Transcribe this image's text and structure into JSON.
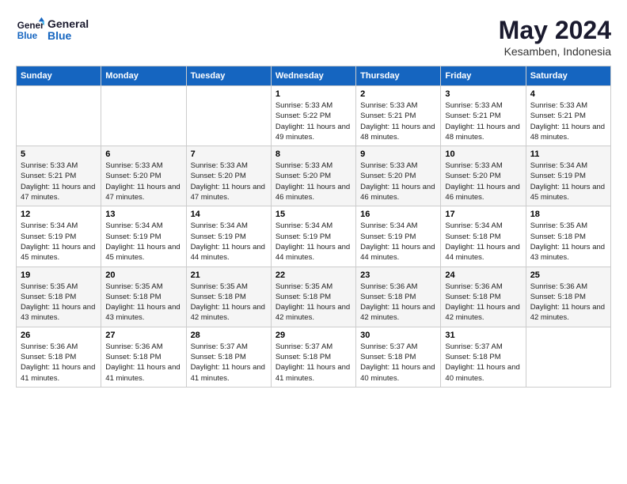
{
  "logo": {
    "text1": "General",
    "text2": "Blue"
  },
  "title": "May 2024",
  "location": "Kesamben, Indonesia",
  "weekdays": [
    "Sunday",
    "Monday",
    "Tuesday",
    "Wednesday",
    "Thursday",
    "Friday",
    "Saturday"
  ],
  "weeks": [
    [
      {
        "day": "",
        "sunrise": "",
        "sunset": "",
        "daylight": ""
      },
      {
        "day": "",
        "sunrise": "",
        "sunset": "",
        "daylight": ""
      },
      {
        "day": "",
        "sunrise": "",
        "sunset": "",
        "daylight": ""
      },
      {
        "day": "1",
        "sunrise": "Sunrise: 5:33 AM",
        "sunset": "Sunset: 5:22 PM",
        "daylight": "Daylight: 11 hours and 49 minutes."
      },
      {
        "day": "2",
        "sunrise": "Sunrise: 5:33 AM",
        "sunset": "Sunset: 5:21 PM",
        "daylight": "Daylight: 11 hours and 48 minutes."
      },
      {
        "day": "3",
        "sunrise": "Sunrise: 5:33 AM",
        "sunset": "Sunset: 5:21 PM",
        "daylight": "Daylight: 11 hours and 48 minutes."
      },
      {
        "day": "4",
        "sunrise": "Sunrise: 5:33 AM",
        "sunset": "Sunset: 5:21 PM",
        "daylight": "Daylight: 11 hours and 48 minutes."
      }
    ],
    [
      {
        "day": "5",
        "sunrise": "Sunrise: 5:33 AM",
        "sunset": "Sunset: 5:21 PM",
        "daylight": "Daylight: 11 hours and 47 minutes."
      },
      {
        "day": "6",
        "sunrise": "Sunrise: 5:33 AM",
        "sunset": "Sunset: 5:20 PM",
        "daylight": "Daylight: 11 hours and 47 minutes."
      },
      {
        "day": "7",
        "sunrise": "Sunrise: 5:33 AM",
        "sunset": "Sunset: 5:20 PM",
        "daylight": "Daylight: 11 hours and 47 minutes."
      },
      {
        "day": "8",
        "sunrise": "Sunrise: 5:33 AM",
        "sunset": "Sunset: 5:20 PM",
        "daylight": "Daylight: 11 hours and 46 minutes."
      },
      {
        "day": "9",
        "sunrise": "Sunrise: 5:33 AM",
        "sunset": "Sunset: 5:20 PM",
        "daylight": "Daylight: 11 hours and 46 minutes."
      },
      {
        "day": "10",
        "sunrise": "Sunrise: 5:33 AM",
        "sunset": "Sunset: 5:20 PM",
        "daylight": "Daylight: 11 hours and 46 minutes."
      },
      {
        "day": "11",
        "sunrise": "Sunrise: 5:34 AM",
        "sunset": "Sunset: 5:19 PM",
        "daylight": "Daylight: 11 hours and 45 minutes."
      }
    ],
    [
      {
        "day": "12",
        "sunrise": "Sunrise: 5:34 AM",
        "sunset": "Sunset: 5:19 PM",
        "daylight": "Daylight: 11 hours and 45 minutes."
      },
      {
        "day": "13",
        "sunrise": "Sunrise: 5:34 AM",
        "sunset": "Sunset: 5:19 PM",
        "daylight": "Daylight: 11 hours and 45 minutes."
      },
      {
        "day": "14",
        "sunrise": "Sunrise: 5:34 AM",
        "sunset": "Sunset: 5:19 PM",
        "daylight": "Daylight: 11 hours and 44 minutes."
      },
      {
        "day": "15",
        "sunrise": "Sunrise: 5:34 AM",
        "sunset": "Sunset: 5:19 PM",
        "daylight": "Daylight: 11 hours and 44 minutes."
      },
      {
        "day": "16",
        "sunrise": "Sunrise: 5:34 AM",
        "sunset": "Sunset: 5:19 PM",
        "daylight": "Daylight: 11 hours and 44 minutes."
      },
      {
        "day": "17",
        "sunrise": "Sunrise: 5:34 AM",
        "sunset": "Sunset: 5:18 PM",
        "daylight": "Daylight: 11 hours and 44 minutes."
      },
      {
        "day": "18",
        "sunrise": "Sunrise: 5:35 AM",
        "sunset": "Sunset: 5:18 PM",
        "daylight": "Daylight: 11 hours and 43 minutes."
      }
    ],
    [
      {
        "day": "19",
        "sunrise": "Sunrise: 5:35 AM",
        "sunset": "Sunset: 5:18 PM",
        "daylight": "Daylight: 11 hours and 43 minutes."
      },
      {
        "day": "20",
        "sunrise": "Sunrise: 5:35 AM",
        "sunset": "Sunset: 5:18 PM",
        "daylight": "Daylight: 11 hours and 43 minutes."
      },
      {
        "day": "21",
        "sunrise": "Sunrise: 5:35 AM",
        "sunset": "Sunset: 5:18 PM",
        "daylight": "Daylight: 11 hours and 42 minutes."
      },
      {
        "day": "22",
        "sunrise": "Sunrise: 5:35 AM",
        "sunset": "Sunset: 5:18 PM",
        "daylight": "Daylight: 11 hours and 42 minutes."
      },
      {
        "day": "23",
        "sunrise": "Sunrise: 5:36 AM",
        "sunset": "Sunset: 5:18 PM",
        "daylight": "Daylight: 11 hours and 42 minutes."
      },
      {
        "day": "24",
        "sunrise": "Sunrise: 5:36 AM",
        "sunset": "Sunset: 5:18 PM",
        "daylight": "Daylight: 11 hours and 42 minutes."
      },
      {
        "day": "25",
        "sunrise": "Sunrise: 5:36 AM",
        "sunset": "Sunset: 5:18 PM",
        "daylight": "Daylight: 11 hours and 42 minutes."
      }
    ],
    [
      {
        "day": "26",
        "sunrise": "Sunrise: 5:36 AM",
        "sunset": "Sunset: 5:18 PM",
        "daylight": "Daylight: 11 hours and 41 minutes."
      },
      {
        "day": "27",
        "sunrise": "Sunrise: 5:36 AM",
        "sunset": "Sunset: 5:18 PM",
        "daylight": "Daylight: 11 hours and 41 minutes."
      },
      {
        "day": "28",
        "sunrise": "Sunrise: 5:37 AM",
        "sunset": "Sunset: 5:18 PM",
        "daylight": "Daylight: 11 hours and 41 minutes."
      },
      {
        "day": "29",
        "sunrise": "Sunrise: 5:37 AM",
        "sunset": "Sunset: 5:18 PM",
        "daylight": "Daylight: 11 hours and 41 minutes."
      },
      {
        "day": "30",
        "sunrise": "Sunrise: 5:37 AM",
        "sunset": "Sunset: 5:18 PM",
        "daylight": "Daylight: 11 hours and 40 minutes."
      },
      {
        "day": "31",
        "sunrise": "Sunrise: 5:37 AM",
        "sunset": "Sunset: 5:18 PM",
        "daylight": "Daylight: 11 hours and 40 minutes."
      },
      {
        "day": "",
        "sunrise": "",
        "sunset": "",
        "daylight": ""
      }
    ]
  ]
}
